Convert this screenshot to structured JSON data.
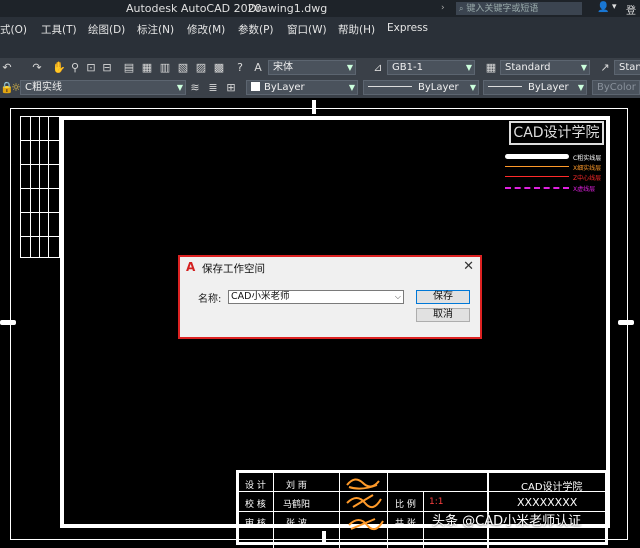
{
  "titlebar": {
    "app_title": "Autodesk AutoCAD 2020",
    "file": "Drawing1.dwg",
    "search_placeholder": "键入关键字或短语",
    "user_fragment": "登"
  },
  "menu": {
    "items": [
      "式(O)",
      "工具(T)",
      "绘图(D)",
      "标注(N)",
      "修改(M)",
      "参数(P)",
      "窗口(W)",
      "帮助(H)",
      "Express"
    ]
  },
  "toolbar1": {
    "font_combo": "宋体",
    "dim_style_combo": "GB1-1",
    "table_style_combo": "Standard",
    "mleader_style_combo": "Standard"
  },
  "toolbar2": {
    "layer_combo": "C粗实线",
    "color_combo": "ByLayer",
    "linetype_combo": "ByLayer",
    "lineweight_combo": "ByLayer",
    "plotstyle_combo": "ByColor"
  },
  "drawing": {
    "brand_box": "CAD设计学院",
    "legend": [
      {
        "label": "C粗实线层",
        "color": "#ffffff"
      },
      {
        "label": "X细实线层",
        "color": "#ff9a2a"
      },
      {
        "label": "Z中心线层",
        "color": "#ff2a2a"
      },
      {
        "label": "X虚线层",
        "color": "#e020e0"
      }
    ]
  },
  "dialog": {
    "title": "保存工作空间",
    "name_label": "名称:",
    "name_value": "CAD小米老师",
    "save_button": "保存",
    "cancel_button": "取消"
  },
  "title_block": {
    "design_label": "设  计",
    "design_name": "刘  雨",
    "check_label": "校  核",
    "check_name": "马鹤阳",
    "review_label": "审  核",
    "review_name": "张  波",
    "scale_label": "比  例",
    "scale_value": "1:1",
    "total_label": "共  张",
    "school": "CAD设计学院",
    "drawing_no": "XXXXXXXX"
  },
  "watermark": "头条 @CAD小米老师认证",
  "colors": {
    "dialog_border": "#dd2222",
    "autocad_logo": "#d42020"
  }
}
